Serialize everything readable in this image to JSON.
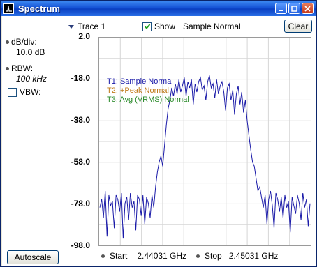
{
  "window": {
    "title": "Spectrum",
    "buttons": [
      "minimize",
      "maximize",
      "close"
    ]
  },
  "toolbar": {
    "trace_label": "Trace 1",
    "show_label": "Show",
    "show_checked": true,
    "sample_mode": "Sample Normal",
    "clear_label": "Clear"
  },
  "side": {
    "dbdiv_label": "dB/div:",
    "dbdiv_value": "10.0 dB",
    "rbw_label": "RBW:",
    "rbw_value": "100 kHz",
    "vbw_label": "VBW:",
    "vbw_checked": false,
    "autoscale_label": "Autoscale"
  },
  "legend": [
    {
      "text": "T1: Sample Normal",
      "color": "#1a1aa8"
    },
    {
      "text": "T2: +Peak Normal",
      "color": "#c07a1a"
    },
    {
      "text": "T3: Avg (VRMS) Normal",
      "color": "#2a8a2a"
    }
  ],
  "freq": {
    "start_label": "Start",
    "start_value": "2.44031 GHz",
    "stop_label": "Stop",
    "stop_value": "2.45031 GHz"
  },
  "chart_data": {
    "type": "line",
    "title": "",
    "xlabel": "",
    "ylabel": "",
    "ylim": [
      -98.0,
      2.0
    ],
    "xlim": [
      2.44031,
      2.45031
    ],
    "yticks": [
      "2.0",
      "-18.0",
      "-38.0",
      "-58.0",
      "-78.0",
      "-98.0"
    ],
    "grid": true,
    "legend_position": "top-left",
    "series": [
      {
        "name": "T1: Sample Normal",
        "color": "#1a1aa8",
        "y": [
          -80,
          -76,
          -85,
          -72,
          -94,
          -74,
          -79,
          -77,
          -90,
          -74,
          -76,
          -82,
          -73,
          -95,
          -78,
          -75,
          -86,
          -73,
          -80,
          -77,
          -91,
          -74,
          -76,
          -84,
          -74,
          -88,
          -75,
          -78,
          -85,
          -74,
          -80,
          -70,
          -63,
          -58,
          -55,
          -60,
          -50,
          -40,
          -32,
          -28,
          -22,
          -26,
          -20,
          -25,
          -18,
          -24,
          -21,
          -17,
          -26,
          -19,
          -22,
          -18,
          -30,
          -20,
          -24,
          -19,
          -17,
          -23,
          -21,
          -28,
          -19,
          -16,
          -22,
          -20,
          -27,
          -18,
          -25,
          -21,
          -19,
          -24,
          -33,
          -22,
          -20,
          -28,
          -23,
          -35,
          -25,
          -21,
          -30,
          -24,
          -34,
          -28,
          -38,
          -45,
          -52,
          -58,
          -60,
          -66,
          -72,
          -70,
          -75,
          -80,
          -74,
          -88,
          -76,
          -72,
          -79,
          -90,
          -73,
          -76,
          -82,
          -75,
          -85,
          -74,
          -80,
          -77,
          -92,
          -75,
          -79,
          -83,
          -74,
          -78,
          -86,
          -73,
          -80,
          -76,
          -89,
          -78
        ]
      }
    ]
  }
}
